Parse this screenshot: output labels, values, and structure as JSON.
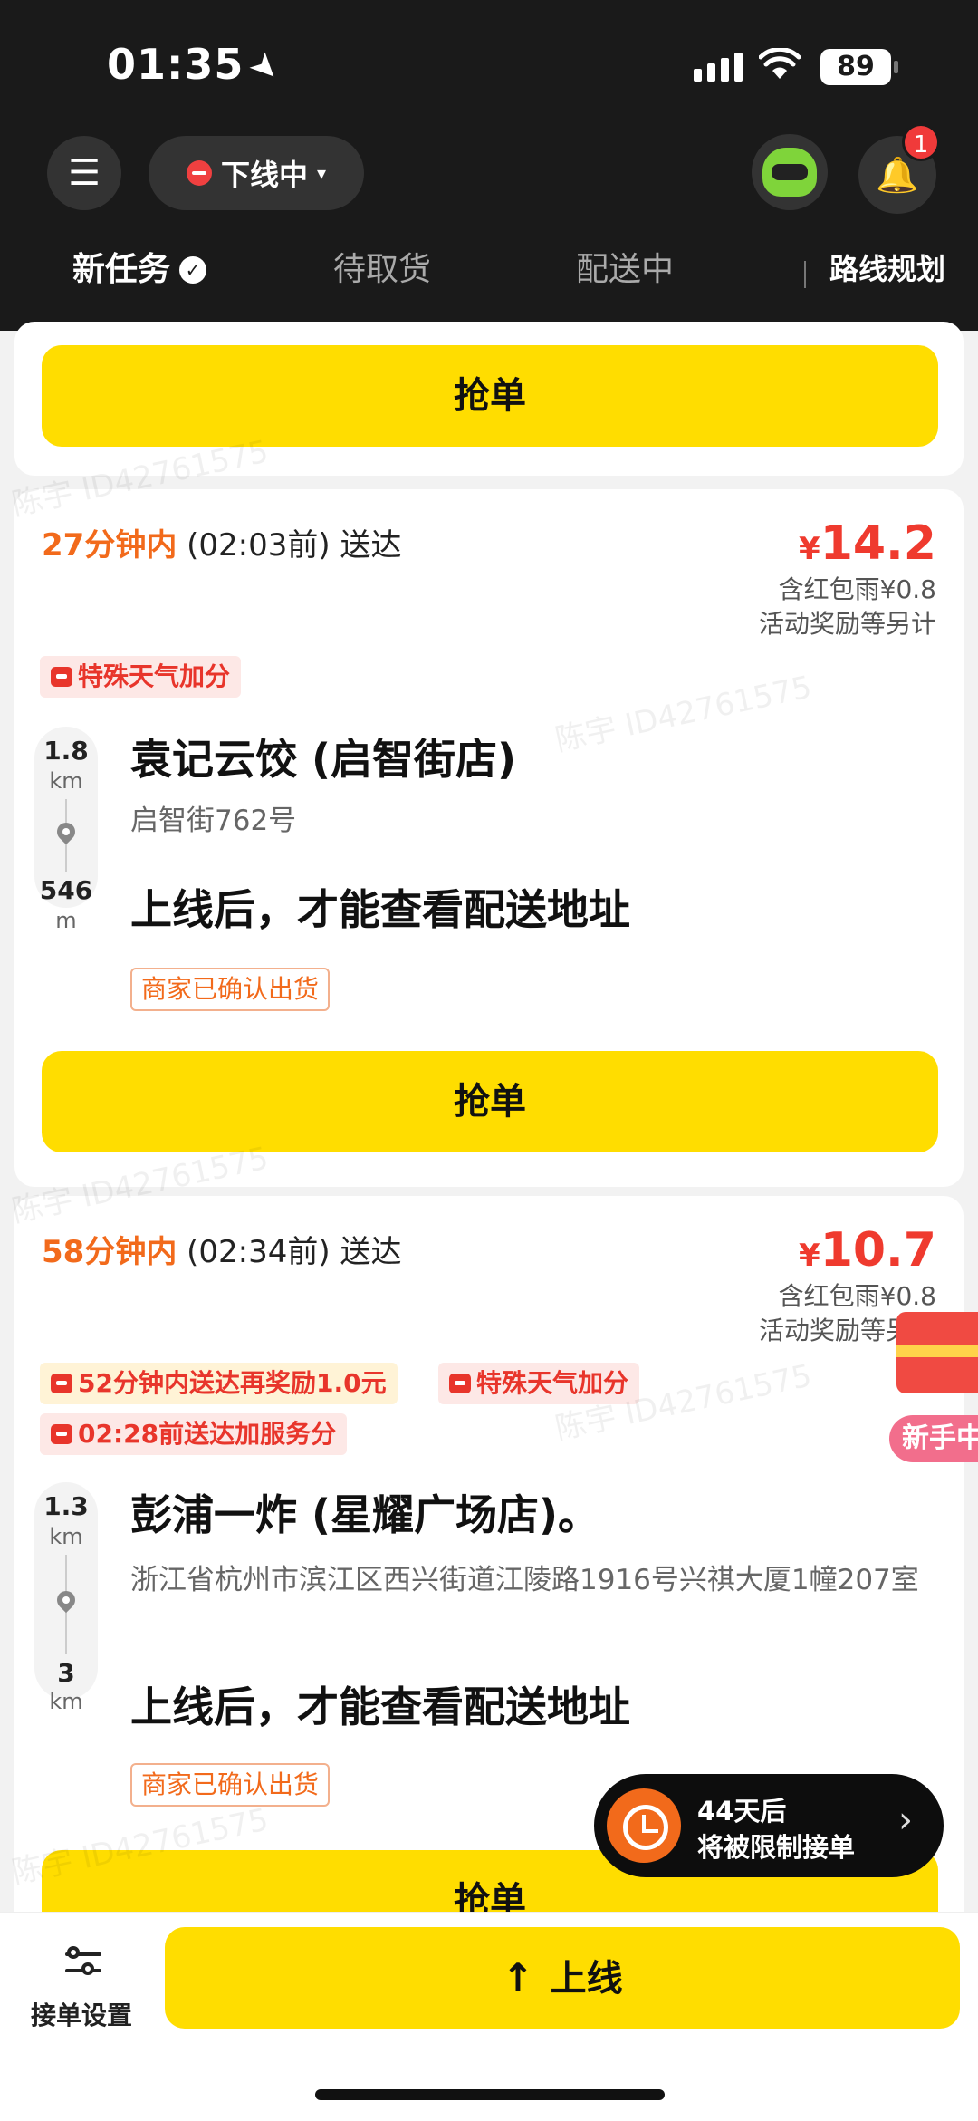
{
  "status_bar": {
    "time": "01:35",
    "location_arrow": "➤",
    "wifi_icon": "wifi-icon",
    "battery": "89"
  },
  "header": {
    "menu_glyph": "☰",
    "online_status": "下线中",
    "online_caret": "▾",
    "notification_count": "1",
    "bell_glyph": "🔔"
  },
  "tabs": {
    "new_tasks": "新任务",
    "new_tasks_check": "✓",
    "pending_pickup": "待取货",
    "delivering": "配送中",
    "route_planning": "路线规划"
  },
  "orders": [
    {
      "grab_label": "抢单"
    },
    {
      "eta_highlight": "27分钟内",
      "eta_rest": "(02:03前) 送达",
      "price_symbol": "¥",
      "price": "14.2",
      "price_note_1": "含红包雨¥0.8",
      "price_note_2": "活动奖励等另计",
      "tags": [
        "特殊天气加分"
      ],
      "pickup_distance": "1.8",
      "pickup_unit": "km",
      "dropoff_distance": "546",
      "dropoff_unit": "m",
      "shop_name": "袁记云饺 (启智街店)",
      "shop_address": "启智街762号",
      "destination": "上线后，才能查看配送地址",
      "merchant_status": "商家已确认出货",
      "grab_label": "抢单"
    },
    {
      "eta_highlight": "58分钟内",
      "eta_rest": "(02:34前) 送达",
      "price_symbol": "¥",
      "price": "10.7",
      "price_note_1": "含红包雨¥0.8",
      "price_note_2": "活动奖励等另计",
      "tags": [
        "52分钟内送达再奖励1.0元",
        "特殊天气加分",
        "02:28前送达加服务分"
      ],
      "pickup_distance": "1.3",
      "pickup_unit": "km",
      "dropoff_distance": "3",
      "dropoff_unit": "km",
      "shop_name": "彭浦一炸 (星耀广场店)。",
      "shop_address": "浙江省杭州市滨江区西兴街道江陵路1916号兴祺大厦1幢207室",
      "destination": "上线后，才能查看配送地址",
      "merchant_status": "商家已确认出货",
      "grab_label": "抢单"
    }
  ],
  "floating": {
    "gift_label": "新手中",
    "restriction_line1": "44天后",
    "restriction_line2": "将被限制接单",
    "restriction_chevron": "›"
  },
  "bottom_bar": {
    "settings_label": "接单设置",
    "go_online_arrow": "↑",
    "go_online_label": "上线"
  },
  "watermark": "陈宇 ID42761575",
  "colors": {
    "accent_yellow": "#ffdd00",
    "eta_orange": "#f26a1b",
    "price_red": "#ef3a2e",
    "header_dark": "#1a1a1a"
  }
}
